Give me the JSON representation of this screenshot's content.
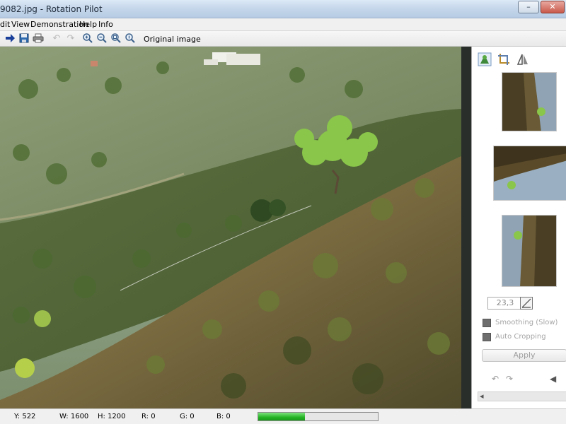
{
  "window": {
    "title": "9082.jpg - Rotation Pilot",
    "minimize_glyph": "–",
    "close_glyph": "✕"
  },
  "menu": {
    "items": [
      "dit",
      "View",
      "Demonstration",
      "Help",
      "Info"
    ]
  },
  "toolbar": {
    "original_image_label": "Original image",
    "icons": [
      "arrow-right-icon",
      "save-icon",
      "print-icon",
      "undo-icon",
      "redo-icon",
      "zoom-in-icon",
      "zoom-out-icon",
      "zoom-fit-icon",
      "zoom-actual-icon"
    ]
  },
  "panel": {
    "tool_icons": [
      "rotate-tool-icon",
      "crop-tool-icon",
      "mirror-tool-icon"
    ],
    "angle_value": "23,3",
    "smoothing_label": "Smoothing (Slow)",
    "auto_cropping_label": "Auto Cropping",
    "apply_label": "Apply",
    "undo_glyph": "↶",
    "redo_glyph": "↷",
    "back_glyph": "◀",
    "scroll_left_glyph": "◂"
  },
  "status": {
    "y": "Y: 522",
    "w": "W: 1600",
    "h": "H: 1200",
    "r": "R: 0",
    "g": "G: 0",
    "b": "B: 0",
    "progress_fraction": 0.39
  },
  "colors": {
    "progress_green": "#23b323",
    "tree_green": "#8ac64a"
  }
}
